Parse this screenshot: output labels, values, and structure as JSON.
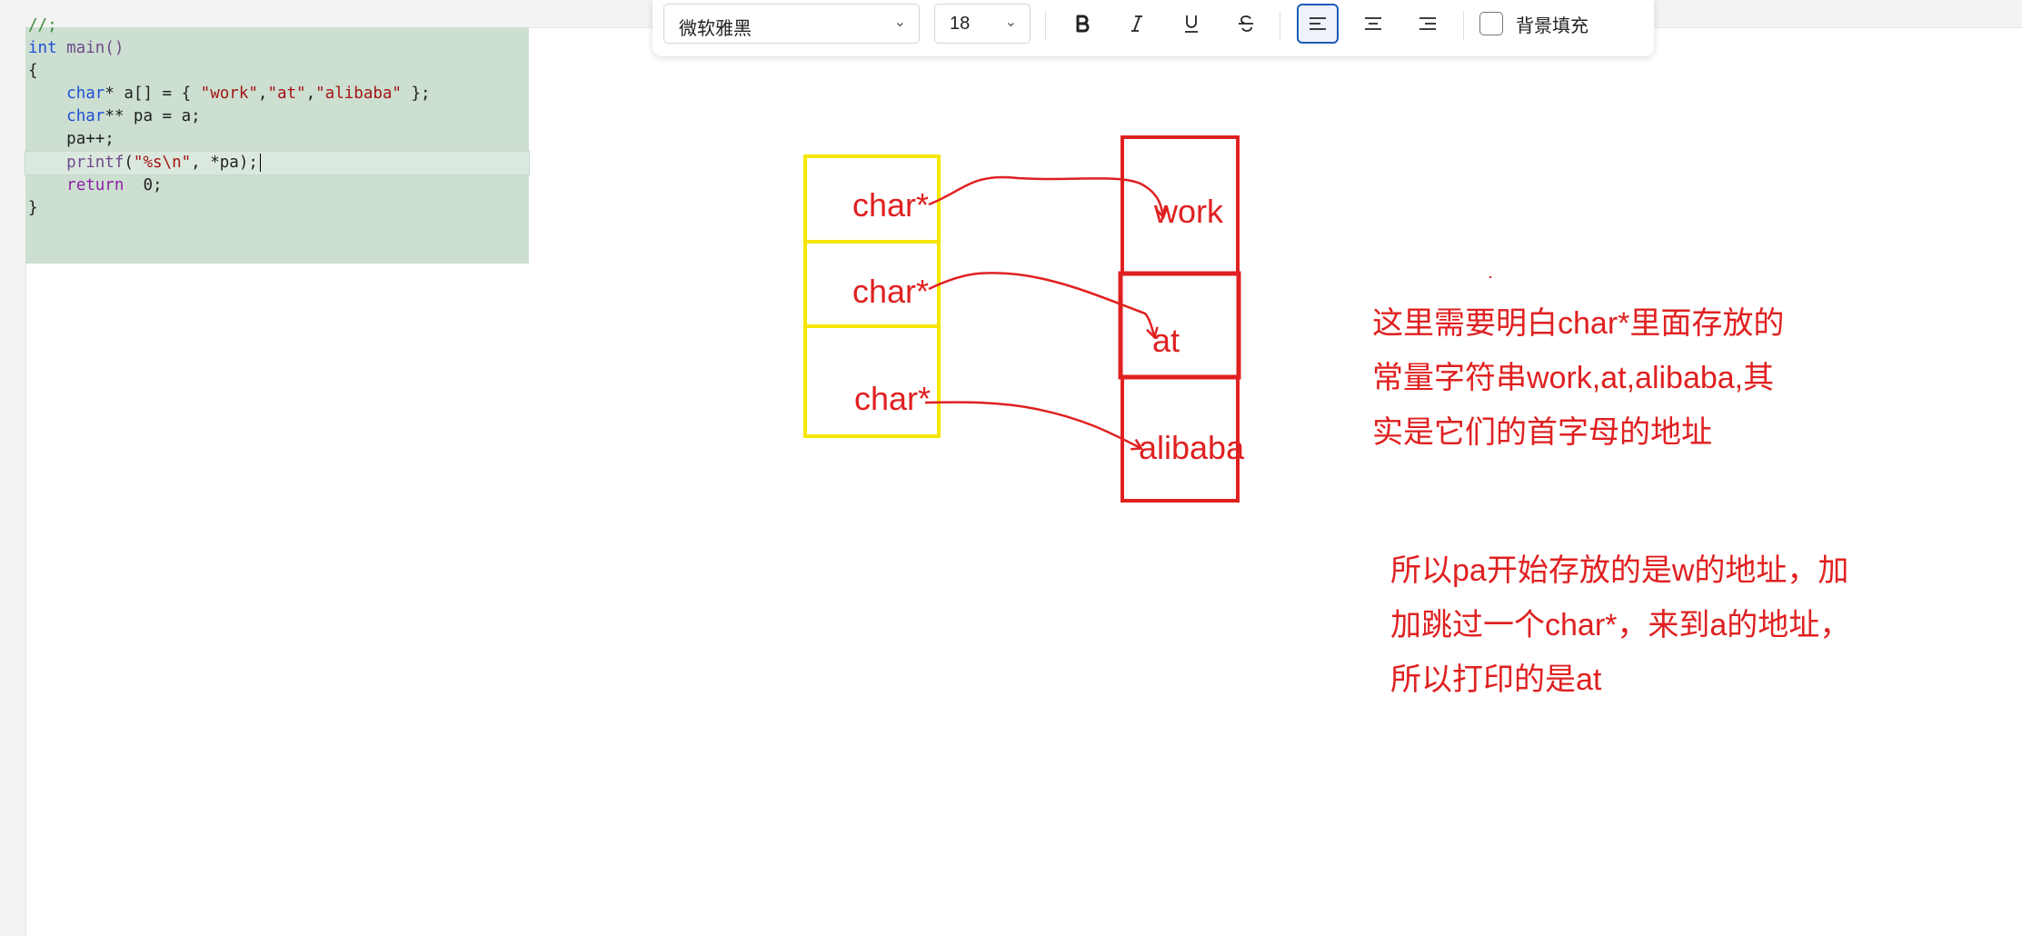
{
  "colors": {
    "accent": "#1e5bb8",
    "annotation": "#e02020",
    "pointer_box": "#f5e600",
    "code_bg": "#ccdfd0"
  },
  "code": {
    "l0": "//;",
    "l1_kw": "int",
    "l1_rest": " main()",
    "l2": "{",
    "l3_kw": "char",
    "l3_a": "* a[] = { ",
    "l3_s1": "\"work\"",
    "l3_c1": ",",
    "l3_s2": "\"at\"",
    "l3_c2": ",",
    "l3_s3": "\"alibaba\"",
    "l3_end": " };",
    "l4_kw": "char",
    "l4_rest": "** pa = a;",
    "l5": "pa++;",
    "l6_fn": "printf",
    "l6_a": "(",
    "l6_s": "\"%s\\n\"",
    "l6_end": ", *pa);",
    "l7_kw": "return",
    "l7_rest": "  0;",
    "l8": "}"
  },
  "toolbar": {
    "font_family": "微软雅黑",
    "font_size": "18",
    "bold_icon": "bold-icon",
    "italic_icon": "italic-icon",
    "underline_icon": "underline-icon",
    "strike_icon": "strikethrough-icon",
    "align_left_icon": "align-left-icon",
    "align_center_icon": "align-center-icon",
    "align_right_icon": "align-right-icon",
    "align_active": "left",
    "background_fill_label": "背景填充",
    "background_fill_checked": false
  },
  "diagram": {
    "pointers": [
      "char*",
      "char*",
      "char*"
    ],
    "strings": [
      "work",
      "at",
      "alibaba"
    ]
  },
  "notes": {
    "note1": "这里需要明白char*里面存放的\n常量字符串work,at,alibaba,其\n实是它们的首字母的地址",
    "note2": "所以pa开始存放的是w的地址，加\n加跳过一个char*，来到a的地址，\n所以打印的是at"
  }
}
